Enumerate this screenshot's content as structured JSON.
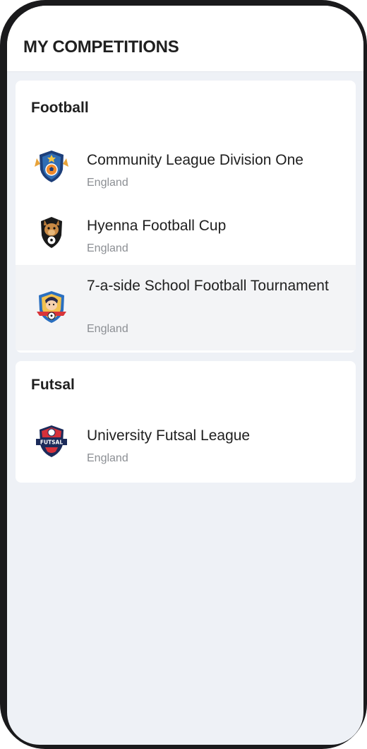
{
  "header": {
    "title": "MY COMPETITIONS"
  },
  "sections": [
    {
      "title": "Football",
      "items": [
        {
          "name": "Community League Division One",
          "country": "England",
          "logo": "shield-ball-wings-icon"
        },
        {
          "name": "Hyenna Football Cup",
          "country": "England",
          "logo": "hyena-crest-icon"
        },
        {
          "name": "7-a-side School Football Tournament",
          "country": "England",
          "logo": "school-boy-crest-icon"
        }
      ]
    },
    {
      "title": "Futsal",
      "items": [
        {
          "name": "University Futsal League",
          "country": "England",
          "logo": "futsal-shield-icon"
        }
      ]
    }
  ],
  "colors": {
    "background": "#eef1f6",
    "card": "#ffffff",
    "highlight": "#f3f4f6",
    "text": "#1f1f1f",
    "subtext": "#8c8f94"
  }
}
